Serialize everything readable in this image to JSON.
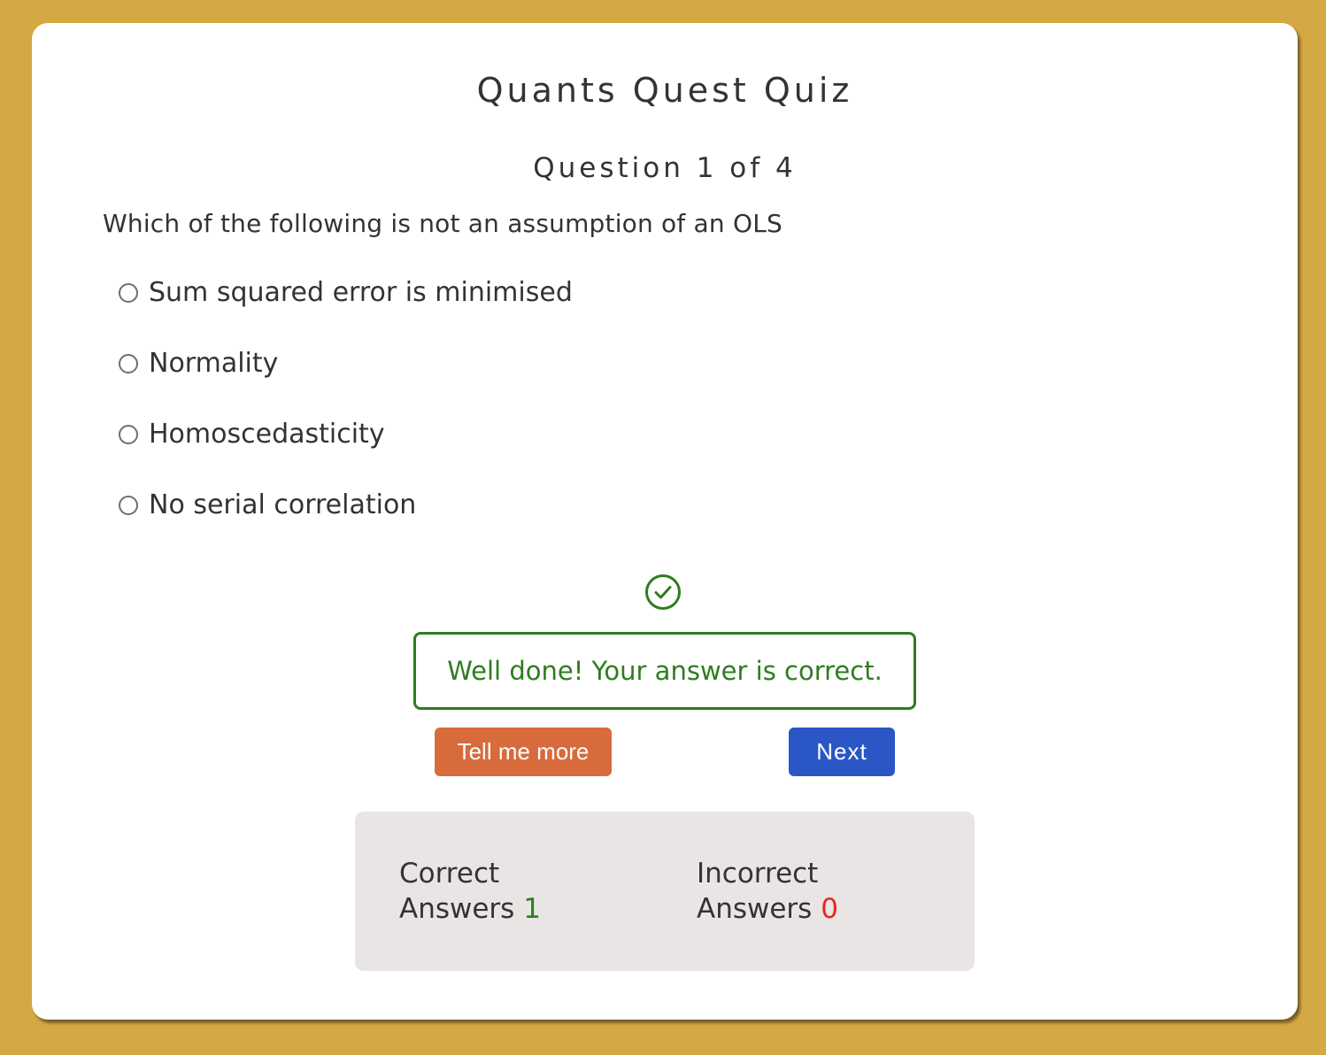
{
  "quiz": {
    "title": "Quants Quest Quiz",
    "counter": "Question 1 of 4",
    "question": "Which of the following is not an assumption of an OLS",
    "options": [
      "Sum squared error is minimised",
      "Normality",
      "Homoscedasticity",
      "No serial correlation"
    ]
  },
  "feedback": {
    "icon": "check-circle-icon",
    "message": "Well done! Your answer is correct.",
    "color": "#2e7d1f"
  },
  "actions": {
    "tell_more_label": "Tell me more",
    "next_label": "Next"
  },
  "scores": {
    "correct_label_line1": "Correct",
    "correct_label_line2": "Answers",
    "correct_value": "1",
    "incorrect_label_line1": "Incorrect",
    "incorrect_label_line2": "Answers",
    "incorrect_value": "0"
  },
  "colors": {
    "background": "#d4a843",
    "card": "#ffffff",
    "tell_more_button": "#d86b3c",
    "next_button": "#2a56c6",
    "correct_value": "#2e7d1f",
    "incorrect_value": "#e8261c",
    "score_panel": "#e8e5e4"
  }
}
